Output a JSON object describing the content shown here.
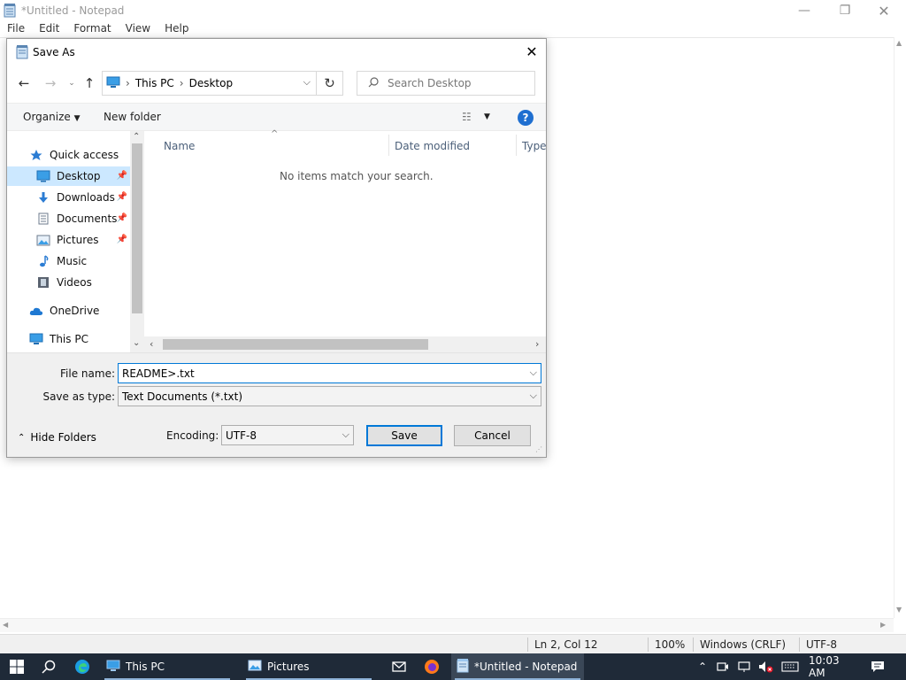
{
  "notepad": {
    "title": "*Untitled - Notepad",
    "menu": [
      "File",
      "Edit",
      "Format",
      "View",
      "Help"
    ],
    "status": {
      "position": "Ln 2, Col 12",
      "zoom": "100%",
      "line_ending": "Windows (CRLF)",
      "encoding": "UTF-8"
    }
  },
  "dialog": {
    "title": "Save As",
    "breadcrumb": [
      "This PC",
      "Desktop"
    ],
    "search_placeholder": "Search Desktop",
    "toolbar": {
      "organize": "Organize",
      "new_folder": "New folder"
    },
    "nav": {
      "quick_access": "Quick access",
      "items": [
        {
          "label": "Desktop",
          "icon": "desktop-icon",
          "pinned": true,
          "selected": true
        },
        {
          "label": "Downloads",
          "icon": "downloads-icon",
          "pinned": true
        },
        {
          "label": "Documents",
          "icon": "documents-icon",
          "pinned": true
        },
        {
          "label": "Pictures",
          "icon": "pictures-icon",
          "pinned": true
        },
        {
          "label": "Music",
          "icon": "music-icon"
        },
        {
          "label": "Videos",
          "icon": "videos-icon"
        }
      ],
      "onedrive": "OneDrive",
      "this_pc": "This PC"
    },
    "columns": [
      "Name",
      "Date modified",
      "Type"
    ],
    "empty_message": "No items match your search.",
    "file_name_label": "File name:",
    "file_name_value": "README>.txt",
    "save_as_type_label": "Save as type:",
    "save_as_type_value": "Text Documents (*.txt)",
    "hide_folders": "Hide Folders",
    "encoding_label": "Encoding:",
    "encoding_value": "UTF-8",
    "save_button": "Save",
    "cancel_button": "Cancel"
  },
  "taskbar": {
    "apps": [
      {
        "label": "This PC",
        "icon": "file-explorer-icon"
      },
      {
        "label": "Pictures",
        "icon": "pictures-window-icon"
      },
      {
        "label": "*Untitled - Notepad",
        "icon": "notepad-icon"
      }
    ],
    "clock": "10:03 AM"
  },
  "colors": {
    "accent": "#0078d7",
    "selected_bg": "#cce8ff",
    "taskbar": "#1f2a38"
  }
}
